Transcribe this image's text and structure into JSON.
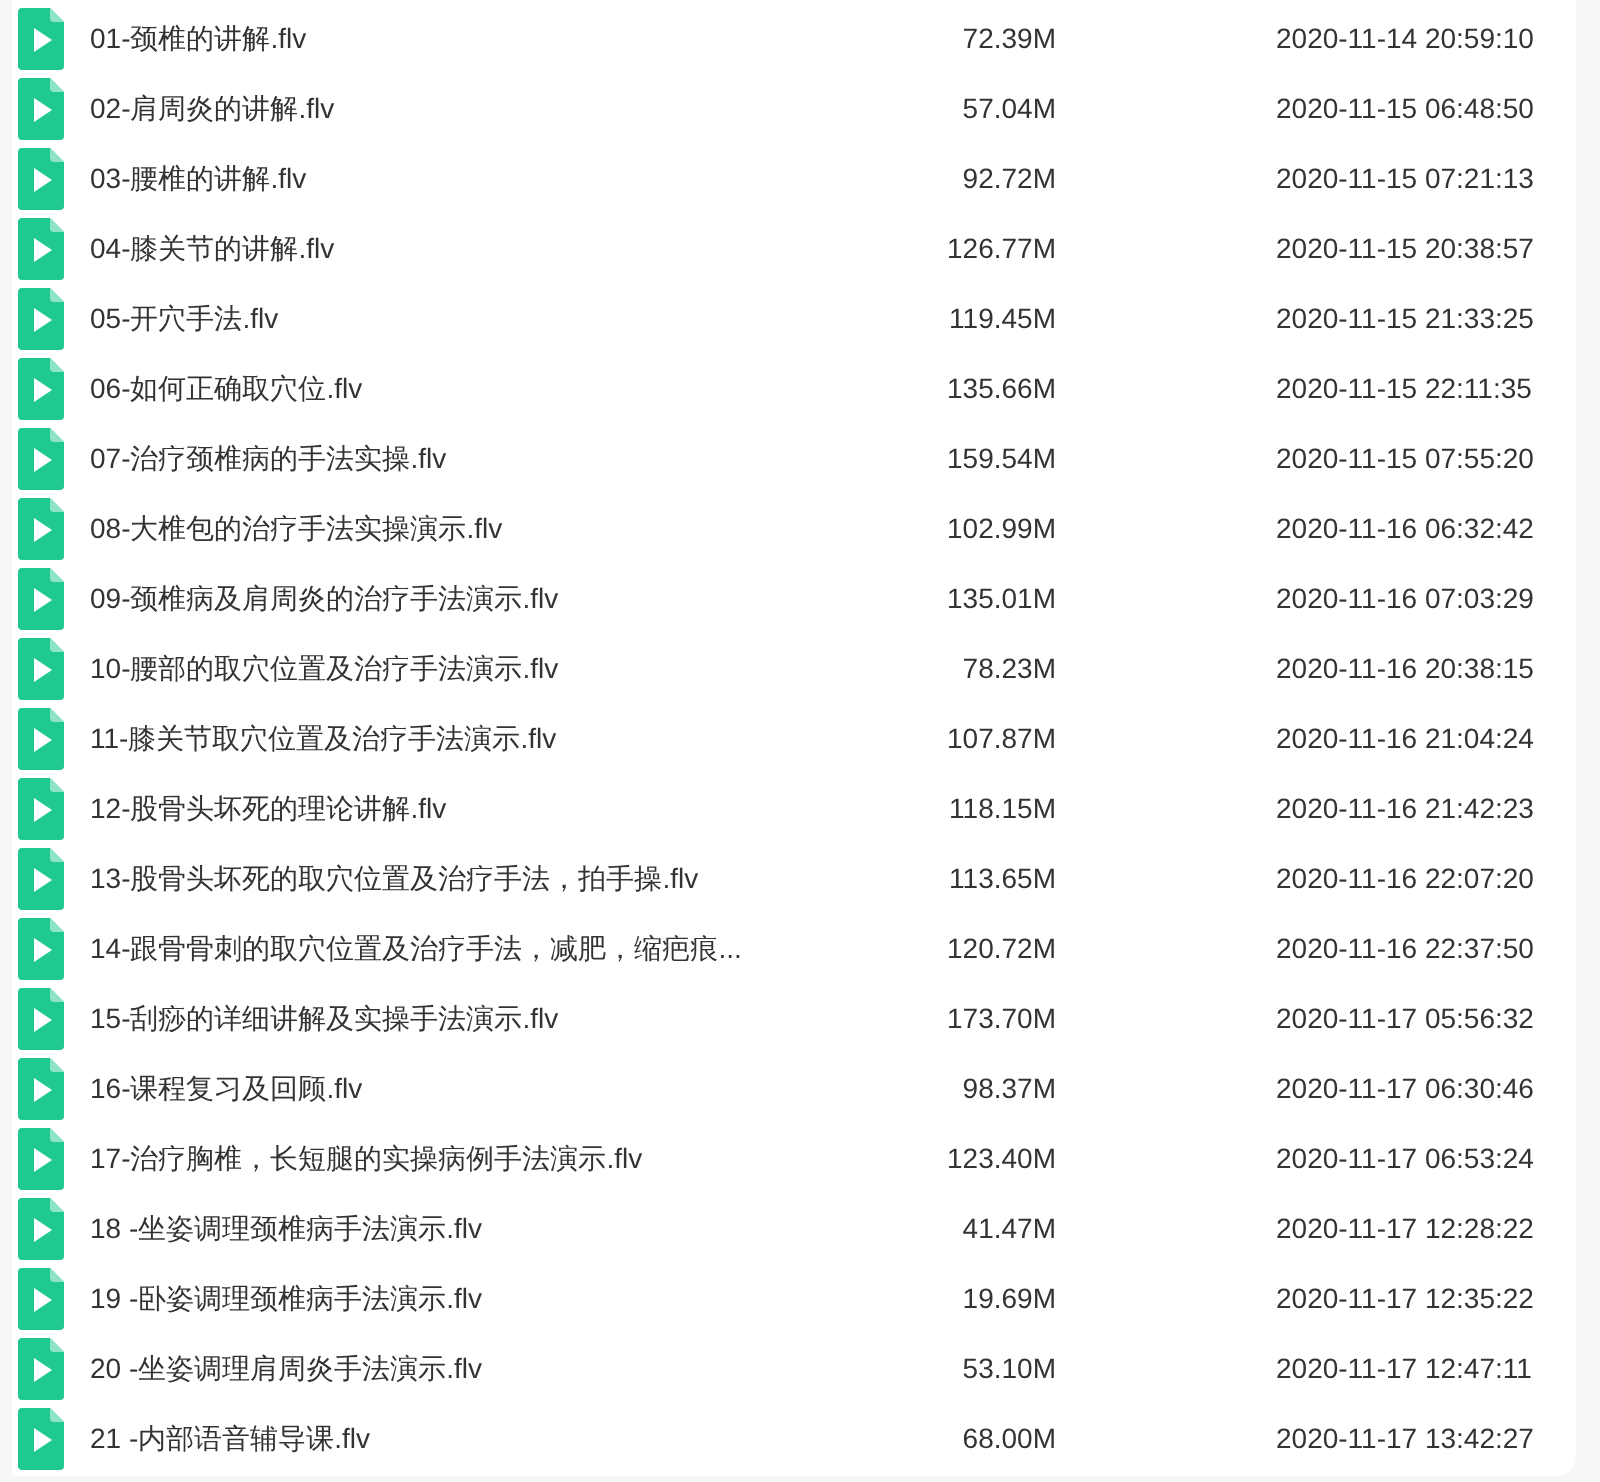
{
  "files": [
    {
      "name": "01-颈椎的讲解.flv",
      "size": "72.39M",
      "modified": "2020-11-14 20:59:10"
    },
    {
      "name": "02-肩周炎的讲解.flv",
      "size": "57.04M",
      "modified": "2020-11-15 06:48:50"
    },
    {
      "name": "03-腰椎的讲解.flv",
      "size": "92.72M",
      "modified": "2020-11-15 07:21:13"
    },
    {
      "name": "04-膝关节的讲解.flv",
      "size": "126.77M",
      "modified": "2020-11-15 20:38:57"
    },
    {
      "name": "05-开穴手法.flv",
      "size": "119.45M",
      "modified": "2020-11-15 21:33:25"
    },
    {
      "name": "06-如何正确取穴位.flv",
      "size": "135.66M",
      "modified": "2020-11-15 22:11:35"
    },
    {
      "name": "07-治疗颈椎病的手法实操.flv",
      "size": "159.54M",
      "modified": "2020-11-15 07:55:20"
    },
    {
      "name": "08-大椎包的治疗手法实操演示.flv",
      "size": "102.99M",
      "modified": "2020-11-16 06:32:42"
    },
    {
      "name": "09-颈椎病及肩周炎的治疗手法演示.flv",
      "size": "135.01M",
      "modified": "2020-11-16 07:03:29"
    },
    {
      "name": "10-腰部的取穴位置及治疗手法演示.flv",
      "size": "78.23M",
      "modified": "2020-11-16 20:38:15"
    },
    {
      "name": "11-膝关节取穴位置及治疗手法演示.flv",
      "size": "107.87M",
      "modified": "2020-11-16 21:04:24"
    },
    {
      "name": "12-股骨头坏死的理论讲解.flv",
      "size": "118.15M",
      "modified": "2020-11-16 21:42:23"
    },
    {
      "name": "13-股骨头坏死的取穴位置及治疗手法，拍手操.flv",
      "size": "113.65M",
      "modified": "2020-11-16 22:07:20"
    },
    {
      "name": "14-跟骨骨刺的取穴位置及治疗手法，减肥，缩疤痕...",
      "size": "120.72M",
      "modified": "2020-11-16 22:37:50"
    },
    {
      "name": "15-刮痧的详细讲解及实操手法演示.flv",
      "size": "173.70M",
      "modified": "2020-11-17 05:56:32"
    },
    {
      "name": "16-课程复习及回顾.flv",
      "size": "98.37M",
      "modified": "2020-11-17 06:30:46"
    },
    {
      "name": "17-治疗胸椎，长短腿的实操病例手法演示.flv",
      "size": "123.40M",
      "modified": "2020-11-17 06:53:24"
    },
    {
      "name": "18 -坐姿调理颈椎病手法演示.flv",
      "size": "41.47M",
      "modified": "2020-11-17 12:28:22"
    },
    {
      "name": "19 -卧姿调理颈椎病手法演示.flv",
      "size": "19.69M",
      "modified": "2020-11-17 12:35:22"
    },
    {
      "name": "20 -坐姿调理肩周炎手法演示.flv",
      "size": "53.10M",
      "modified": "2020-11-17 12:47:11"
    },
    {
      "name": "21 -内部语音辅导课.flv",
      "size": "68.00M",
      "modified": "2020-11-17 13:42:27"
    }
  ]
}
